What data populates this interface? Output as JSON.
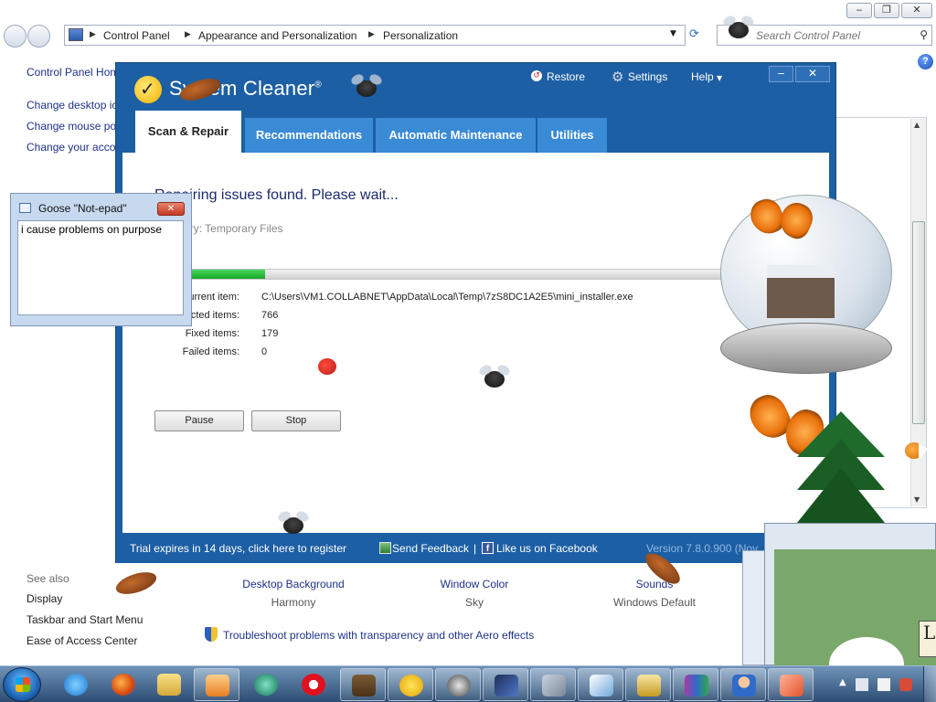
{
  "control_panel": {
    "breadcrumbs": [
      "Control Panel",
      "Appearance and Personalization",
      "Personalization"
    ],
    "search_placeholder": "Search Control Panel",
    "sidebar": {
      "links": [
        "Control Panel Home",
        "Change desktop icons",
        "Change mouse pointers",
        "Change your account picture"
      ],
      "see_also_label": "See also",
      "see_also": [
        "Display",
        "Taskbar and Start Menu",
        "Ease of Access Center"
      ]
    },
    "themes": [
      {
        "title": "Desktop Background",
        "sub": "Harmony"
      },
      {
        "title": "Window Color",
        "sub": "Sky"
      },
      {
        "title": "Sounds",
        "sub": "Windows Default"
      }
    ],
    "troubleshoot_link": "Troubleshoot problems with transparency and other Aero effects"
  },
  "system_cleaner": {
    "title": "System Cleaner",
    "title_mark": "®",
    "top_links": {
      "restore": "Restore",
      "settings": "Settings",
      "help": "Help"
    },
    "tabs": [
      "Scan & Repair",
      "Recommendations",
      "Automatic Maintenance",
      "Utilities"
    ],
    "active_tab": "Scan & Repair",
    "heading": "Repairing issues found. Please wait...",
    "category": "Category: Temporary Files",
    "progress_fraction": 0.17,
    "stats": [
      {
        "label": "Current item:",
        "value": "C:\\Users\\VM1.COLLABNET\\AppData\\Local\\Temp\\7zS8DC1A2E5\\mini_installer.exe"
      },
      {
        "label": "Selected items:",
        "value": "766"
      },
      {
        "label": "Fixed items:",
        "value": "179"
      },
      {
        "label": "Failed items:",
        "value": "0"
      }
    ],
    "buttons": {
      "pause": "Pause",
      "stop": "Stop"
    },
    "footer": {
      "trial": "Trial expires in 14 days, click here to register",
      "feedback": "Send Feedback",
      "separator": "|",
      "facebook": "Like us on Facebook",
      "version": "Version 7.8.0.900 (Nov..."
    }
  },
  "goose_notepad": {
    "title": "Goose \"Not-epad\"",
    "text": "i cause problems on purpose"
  },
  "mini_window": {
    "sign_text": "Lo"
  },
  "colors": {
    "cleaner_blue": "#1d5fa4",
    "tab_blue": "#3a8bd6",
    "progress_green": "#17a72a",
    "link_blue": "#1e3287"
  },
  "icons": [
    "control-panel-icon",
    "search-icon",
    "help-icon",
    "shield-icon",
    "restore-icon",
    "gear-icon",
    "facebook-icon",
    "windows-logo-icon"
  ],
  "taskbar": {
    "apps": [
      "internet-explorer",
      "firefox",
      "windows-explorer",
      "media-player",
      "edge-like-browser",
      "opera",
      "minecraft",
      "system-cleaner",
      "speedometer-app",
      "monitor-app",
      "chain-app",
      "paint-app",
      "cleanup-app",
      "winrar",
      "user-app",
      "eraser-app"
    ]
  }
}
